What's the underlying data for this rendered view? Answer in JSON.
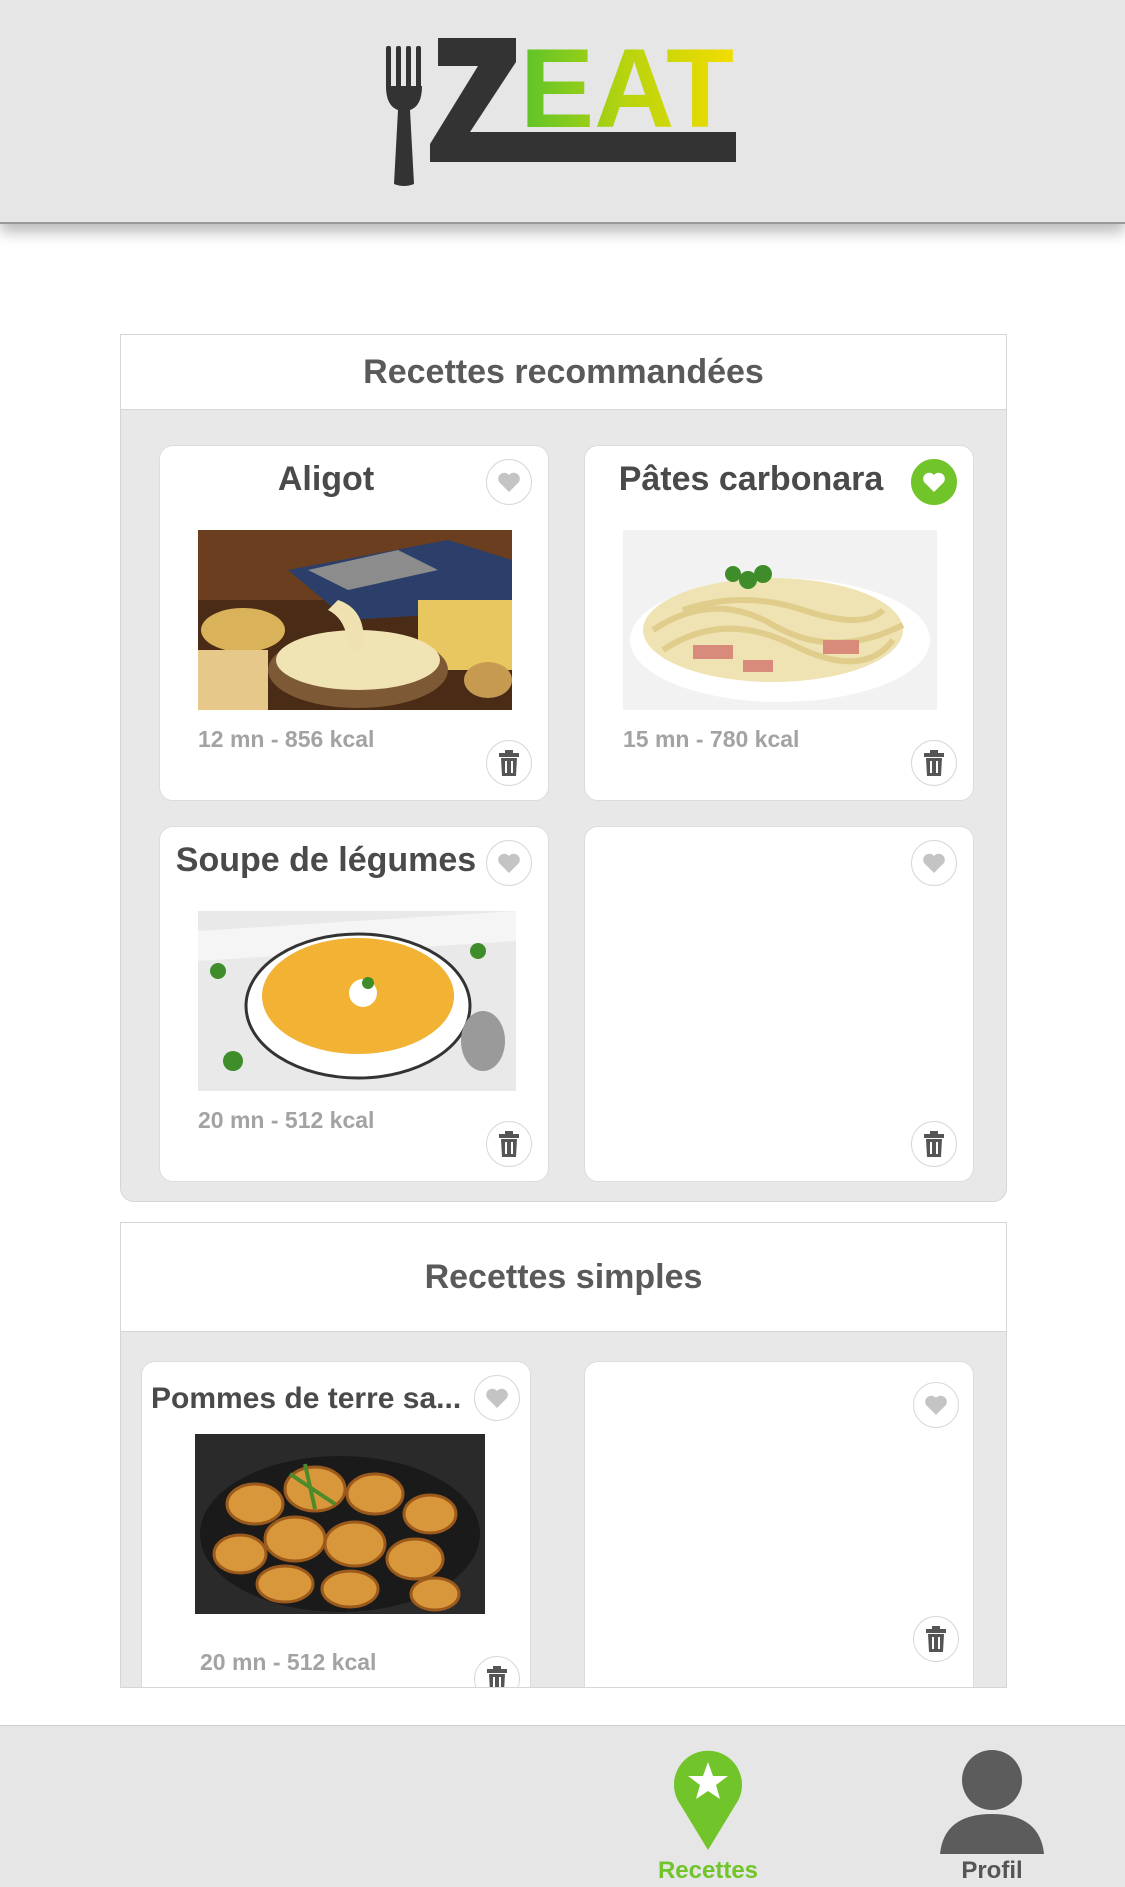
{
  "app": {
    "logo_text": "ZEAT",
    "colors": {
      "accent": "#71c52b",
      "header_bg": "#e6e6e6",
      "text": "#5a5a5a"
    }
  },
  "sections": [
    {
      "title": "Recettes recommandées",
      "cards": [
        {
          "title": "Aligot",
          "meta": "12 mn - 856 kcal",
          "favorite": false,
          "image": "aligot-photo"
        },
        {
          "title": "Pâtes carbonara",
          "meta": "15 mn - 780 kcal",
          "favorite": true,
          "image": "carbonara-photo"
        },
        {
          "title": "Soupe de légumes",
          "meta": "20 mn - 512 kcal",
          "favorite": false,
          "image": "soup-photo"
        },
        {
          "title": "",
          "meta": "",
          "favorite": false,
          "image": ""
        }
      ]
    },
    {
      "title": "Recettes simples",
      "cards": [
        {
          "title": "Pommes de terre sa...",
          "meta": "20 mn - 512 kcal",
          "favorite": false,
          "image": "potatoes-photo"
        },
        {
          "title": "",
          "meta": "",
          "favorite": false,
          "image": ""
        }
      ]
    }
  ],
  "tabbar": {
    "items": [
      {
        "label": "Recettes",
        "icon": "star-pin-icon",
        "active": true
      },
      {
        "label": "Profil",
        "icon": "user-icon",
        "active": false
      }
    ]
  }
}
